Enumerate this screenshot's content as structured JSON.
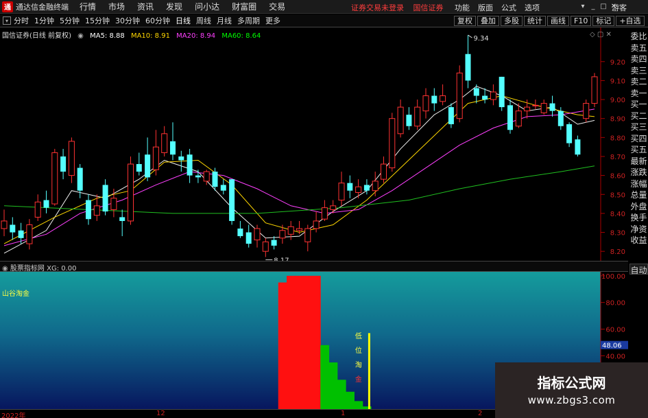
{
  "app": {
    "title": "通达信金融终端",
    "logo_char": "通"
  },
  "menu": [
    "行情",
    "市场",
    "资讯",
    "发现",
    "问小达",
    "财富圈",
    "交易"
  ],
  "notices": [
    "证券交易未登录",
    "国信证券"
  ],
  "top_right": [
    "功能",
    "版面",
    "公式",
    "选项"
  ],
  "user": "游客",
  "window_buttons": [
    "▾",
    "_",
    "□",
    "✕"
  ],
  "periods": [
    "分时",
    "1分钟",
    "5分钟",
    "15分钟",
    "30分钟",
    "60分钟",
    "日线",
    "周线",
    "月线",
    "多周期",
    "更多"
  ],
  "active_period": "日线",
  "toolbar_right": [
    "复权",
    "叠加",
    "多股",
    "统计",
    "画线",
    "F10",
    "标记",
    "+自选"
  ],
  "chart": {
    "stock": "国信证券(日线 前复权)",
    "ma": [
      {
        "label": "MA5: 8.88",
        "color": "#ffffff"
      },
      {
        "label": "MA10: 8.91",
        "color": "#ffd700"
      },
      {
        "label": "MA20: 8.94",
        "color": "#ff40ff"
      },
      {
        "label": "MA60: 8.64",
        "color": "#00ff00"
      }
    ],
    "high_label": "9.34",
    "low_label": "8.17"
  },
  "side_tabs": [
    "委比",
    "卖五",
    "卖四",
    "卖三",
    "卖二",
    "卖一",
    "买一",
    "买二",
    "买三",
    "买四",
    "买五",
    "最新",
    "涨跌",
    "涨幅",
    "总量",
    "外盘",
    "换手",
    "净资",
    "收益"
  ],
  "indicator": {
    "bar": "股票指标网 XG: 0.00",
    "name": "山谷淘金",
    "signal_text": [
      "低",
      "位",
      "淘",
      "金"
    ],
    "current_value": "48.06"
  },
  "auto_label": "自动",
  "dates": [
    "2022年",
    "12",
    "1",
    "2"
  ],
  "watermark": {
    "line1": "指标公式网",
    "line2": "www.zbgs3.com"
  },
  "chart_data": [
    {
      "type": "candlestick",
      "title": "国信证券(日线 前复权)",
      "y_ticks": [
        8.2,
        8.3,
        8.4,
        8.5,
        8.6,
        8.7,
        8.8,
        8.9,
        9.0,
        9.1,
        9.2
      ],
      "ylim": [
        8.15,
        9.38
      ],
      "candles": [
        {
          "o": 8.32,
          "c": 8.36,
          "h": 8.42,
          "l": 8.28
        },
        {
          "o": 8.34,
          "c": 8.3,
          "h": 8.38,
          "l": 8.26
        },
        {
          "o": 8.31,
          "c": 8.27,
          "h": 8.35,
          "l": 8.24
        },
        {
          "o": 8.24,
          "c": 8.34,
          "h": 8.37,
          "l": 8.21
        },
        {
          "o": 8.38,
          "c": 8.46,
          "h": 8.5,
          "l": 8.36
        },
        {
          "o": 8.47,
          "c": 8.43,
          "h": 8.52,
          "l": 8.4
        },
        {
          "o": 8.45,
          "c": 8.72,
          "h": 8.74,
          "l": 8.44
        },
        {
          "o": 8.7,
          "c": 8.62,
          "h": 8.74,
          "l": 8.58
        },
        {
          "o": 8.6,
          "c": 8.78,
          "h": 8.8,
          "l": 8.56
        },
        {
          "o": 8.64,
          "c": 8.52,
          "h": 8.66,
          "l": 8.48
        },
        {
          "o": 8.47,
          "c": 8.37,
          "h": 8.5,
          "l": 8.34
        },
        {
          "o": 8.39,
          "c": 8.44,
          "h": 8.5,
          "l": 8.36
        },
        {
          "o": 8.55,
          "c": 8.41,
          "h": 8.58,
          "l": 8.39
        },
        {
          "o": 8.42,
          "c": 8.48,
          "h": 8.53,
          "l": 8.38
        },
        {
          "o": 8.38,
          "c": 8.36,
          "h": 8.42,
          "l": 8.28
        },
        {
          "o": 8.36,
          "c": 8.66,
          "h": 8.7,
          "l": 8.34
        },
        {
          "o": 8.66,
          "c": 8.62,
          "h": 8.72,
          "l": 8.6
        },
        {
          "o": 8.71,
          "c": 8.59,
          "h": 8.8,
          "l": 8.57
        },
        {
          "o": 8.63,
          "c": 8.75,
          "h": 8.84,
          "l": 8.6
        },
        {
          "o": 8.72,
          "c": 8.82,
          "h": 8.86,
          "l": 8.7
        },
        {
          "o": 8.78,
          "c": 8.71,
          "h": 8.88,
          "l": 8.68
        },
        {
          "o": 8.7,
          "c": 8.68,
          "h": 8.73,
          "l": 8.62
        },
        {
          "o": 8.71,
          "c": 8.6,
          "h": 8.74,
          "l": 8.56
        },
        {
          "o": 8.6,
          "c": 8.59,
          "h": 8.63,
          "l": 8.56
        },
        {
          "o": 8.57,
          "c": 8.62,
          "h": 8.63,
          "l": 8.55
        },
        {
          "o": 8.62,
          "c": 8.54,
          "h": 8.64,
          "l": 8.52
        },
        {
          "o": 8.55,
          "c": 8.52,
          "h": 8.58,
          "l": 8.5
        },
        {
          "o": 8.58,
          "c": 8.36,
          "h": 8.58,
          "l": 8.34
        },
        {
          "o": 8.32,
          "c": 8.28,
          "h": 8.36,
          "l": 8.27
        },
        {
          "o": 8.3,
          "c": 8.24,
          "h": 8.34,
          "l": 8.22
        },
        {
          "o": 8.26,
          "c": 8.32,
          "h": 8.34,
          "l": 8.22
        },
        {
          "o": 8.2,
          "c": 8.25,
          "h": 8.27,
          "l": 8.17
        },
        {
          "o": 8.26,
          "c": 8.23,
          "h": 8.28,
          "l": 8.21
        },
        {
          "o": 8.27,
          "c": 8.31,
          "h": 8.34,
          "l": 8.24
        },
        {
          "o": 8.29,
          "c": 8.33,
          "h": 8.36,
          "l": 8.26
        },
        {
          "o": 8.31,
          "c": 8.32,
          "h": 8.36,
          "l": 8.29
        },
        {
          "o": 8.25,
          "c": 8.32,
          "h": 8.34,
          "l": 8.2
        },
        {
          "o": 8.32,
          "c": 8.36,
          "h": 8.41,
          "l": 8.3
        },
        {
          "o": 8.37,
          "c": 8.43,
          "h": 8.47,
          "l": 8.36
        },
        {
          "o": 8.42,
          "c": 8.44,
          "h": 8.47,
          "l": 8.4
        },
        {
          "o": 8.47,
          "c": 8.56,
          "h": 8.62,
          "l": 8.44
        },
        {
          "o": 8.56,
          "c": 8.52,
          "h": 8.6,
          "l": 8.48
        },
        {
          "o": 8.51,
          "c": 8.54,
          "h": 8.58,
          "l": 8.48
        },
        {
          "o": 8.55,
          "c": 8.52,
          "h": 8.58,
          "l": 8.5
        },
        {
          "o": 8.52,
          "c": 8.57,
          "h": 8.62,
          "l": 8.49
        },
        {
          "o": 8.58,
          "c": 8.66,
          "h": 8.7,
          "l": 8.56
        },
        {
          "o": 8.64,
          "c": 8.9,
          "h": 8.93,
          "l": 8.62
        },
        {
          "o": 8.82,
          "c": 8.96,
          "h": 9.0,
          "l": 8.8
        },
        {
          "o": 8.92,
          "c": 8.86,
          "h": 8.96,
          "l": 8.84
        },
        {
          "o": 8.86,
          "c": 8.96,
          "h": 9.0,
          "l": 8.84
        },
        {
          "o": 8.94,
          "c": 9.02,
          "h": 9.06,
          "l": 8.9
        },
        {
          "o": 9.02,
          "c": 8.98,
          "h": 9.06,
          "l": 8.94
        },
        {
          "o": 8.99,
          "c": 9.02,
          "h": 9.08,
          "l": 8.97
        },
        {
          "o": 8.96,
          "c": 8.87,
          "h": 8.98,
          "l": 8.85
        },
        {
          "o": 8.9,
          "c": 9.14,
          "h": 9.18,
          "l": 8.88
        },
        {
          "o": 9.24,
          "c": 9.1,
          "h": 9.34,
          "l": 9.06
        },
        {
          "o": 9.06,
          "c": 9.02,
          "h": 9.08,
          "l": 8.98
        },
        {
          "o": 9.02,
          "c": 9.0,
          "h": 9.06,
          "l": 8.98
        },
        {
          "o": 9.0,
          "c": 9.04,
          "h": 9.08,
          "l": 8.97
        },
        {
          "o": 9.12,
          "c": 8.96,
          "h": 9.12,
          "l": 8.94
        },
        {
          "o": 8.97,
          "c": 8.84,
          "h": 9.0,
          "l": 8.82
        },
        {
          "o": 8.86,
          "c": 8.94,
          "h": 8.98,
          "l": 8.85
        },
        {
          "o": 8.94,
          "c": 8.96,
          "h": 9.0,
          "l": 8.9
        },
        {
          "o": 8.97,
          "c": 8.97,
          "h": 9.0,
          "l": 8.95
        },
        {
          "o": 8.93,
          "c": 8.98,
          "h": 9.0,
          "l": 8.92
        },
        {
          "o": 8.98,
          "c": 8.94,
          "h": 9.02,
          "l": 8.91
        },
        {
          "o": 8.94,
          "c": 8.86,
          "h": 8.96,
          "l": 8.84
        },
        {
          "o": 8.87,
          "c": 8.77,
          "h": 8.88,
          "l": 8.75
        },
        {
          "o": 8.79,
          "c": 8.71,
          "h": 8.81,
          "l": 8.7
        },
        {
          "o": 8.9,
          "c": 8.98,
          "h": 9.0,
          "l": 8.88
        },
        {
          "o": 8.98,
          "c": 9.12,
          "h": 9.14,
          "l": 8.96
        }
      ],
      "ma_lines": {
        "MA5": [
          [
            0,
            8.19
          ],
          [
            5,
            8.31
          ],
          [
            8,
            8.52
          ],
          [
            12,
            8.48
          ],
          [
            16,
            8.58
          ],
          [
            19,
            8.68
          ],
          [
            23,
            8.62
          ],
          [
            27,
            8.43
          ],
          [
            31,
            8.27
          ],
          [
            35,
            8.28
          ],
          [
            39,
            8.41
          ],
          [
            43,
            8.52
          ],
          [
            47,
            8.74
          ],
          [
            51,
            8.92
          ],
          [
            54,
            9.0
          ],
          [
            56,
            9.07
          ],
          [
            59,
            9.02
          ],
          [
            62,
            8.94
          ],
          [
            65,
            8.96
          ],
          [
            68,
            8.87
          ],
          [
            70,
            8.89
          ]
        ],
        "MA10": [
          [
            0,
            8.24
          ],
          [
            6,
            8.38
          ],
          [
            11,
            8.48
          ],
          [
            15,
            8.52
          ],
          [
            19,
            8.67
          ],
          [
            23,
            8.68
          ],
          [
            27,
            8.55
          ],
          [
            31,
            8.35
          ],
          [
            35,
            8.3
          ],
          [
            39,
            8.34
          ],
          [
            43,
            8.47
          ],
          [
            47,
            8.64
          ],
          [
            51,
            8.81
          ],
          [
            55,
            8.98
          ],
          [
            59,
            9.02
          ],
          [
            63,
            8.97
          ],
          [
            66,
            8.94
          ],
          [
            68,
            8.92
          ],
          [
            70,
            8.91
          ]
        ],
        "MA20": [
          [
            0,
            8.23
          ],
          [
            5,
            8.29
          ],
          [
            9,
            8.4
          ],
          [
            14,
            8.47
          ],
          [
            18,
            8.55
          ],
          [
            22,
            8.62
          ],
          [
            26,
            8.6
          ],
          [
            30,
            8.53
          ],
          [
            34,
            8.44
          ],
          [
            38,
            8.4
          ],
          [
            42,
            8.42
          ],
          [
            46,
            8.52
          ],
          [
            50,
            8.64
          ],
          [
            54,
            8.76
          ],
          [
            58,
            8.85
          ],
          [
            62,
            8.91
          ],
          [
            66,
            8.92
          ],
          [
            70,
            8.95
          ]
        ],
        "MA60": [
          [
            0,
            8.44
          ],
          [
            10,
            8.42
          ],
          [
            20,
            8.4
          ],
          [
            30,
            8.4
          ],
          [
            40,
            8.43
          ],
          [
            48,
            8.47
          ],
          [
            54,
            8.53
          ],
          [
            60,
            8.58
          ],
          [
            66,
            8.62
          ],
          [
            70,
            8.65
          ]
        ]
      }
    },
    {
      "type": "bar",
      "title": "山谷淘金",
      "y_ticks": [
        40,
        60,
        80,
        100
      ],
      "ylim": [
        0,
        103
      ],
      "series": [
        {
          "name": "红",
          "color": "#ff1010",
          "points": [
            [
              33,
              95
            ],
            [
              34,
              100
            ],
            [
              35,
              100
            ],
            [
              36,
              100
            ],
            [
              37,
              100
            ]
          ]
        },
        {
          "name": "绿",
          "color": "#00c000",
          "points": [
            [
              38,
              48
            ],
            [
              39,
              35
            ],
            [
              40,
              22
            ],
            [
              41,
              13
            ],
            [
              42,
              6
            ],
            [
              43,
              2
            ]
          ]
        },
        {
          "name": "黄",
          "color": "#ffff00",
          "points": [
            [
              43,
              57
            ]
          ]
        }
      ]
    }
  ]
}
